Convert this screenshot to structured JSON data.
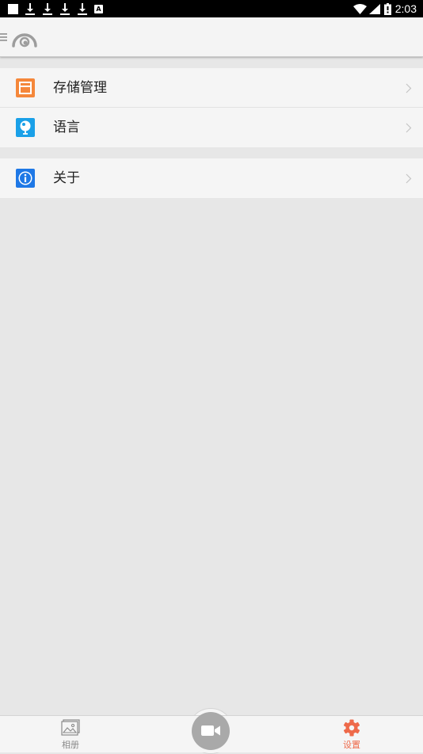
{
  "status_bar": {
    "time": "2:03",
    "notification_icons": [
      "app-icon",
      "download-icon",
      "download-icon",
      "download-icon",
      "download-icon",
      "a-badge-icon"
    ],
    "system_icons": [
      "wifi-icon",
      "signal-icon",
      "battery-icon"
    ]
  },
  "header": {
    "menu_icon": "menu-icon",
    "logo_icon": "camera-logo-icon"
  },
  "settings": {
    "group1": [
      {
        "label": "存储管理",
        "icon": "storage-icon",
        "color": "#f5873a"
      },
      {
        "label": "语言",
        "icon": "language-icon",
        "color": "#1aa0e8"
      }
    ],
    "group2": [
      {
        "label": "关于",
        "icon": "info-icon",
        "color": "#1e78e6"
      }
    ]
  },
  "tab_bar": {
    "album_label": "相册",
    "record_icon": "video-camera-icon",
    "settings_label": "设置",
    "active_color": "#ee6a4a",
    "inactive_color": "#8a8a8a"
  },
  "colors": {
    "background": "#e7e7e7",
    "row_background": "#f5f5f5",
    "status_bar": "#000000"
  }
}
